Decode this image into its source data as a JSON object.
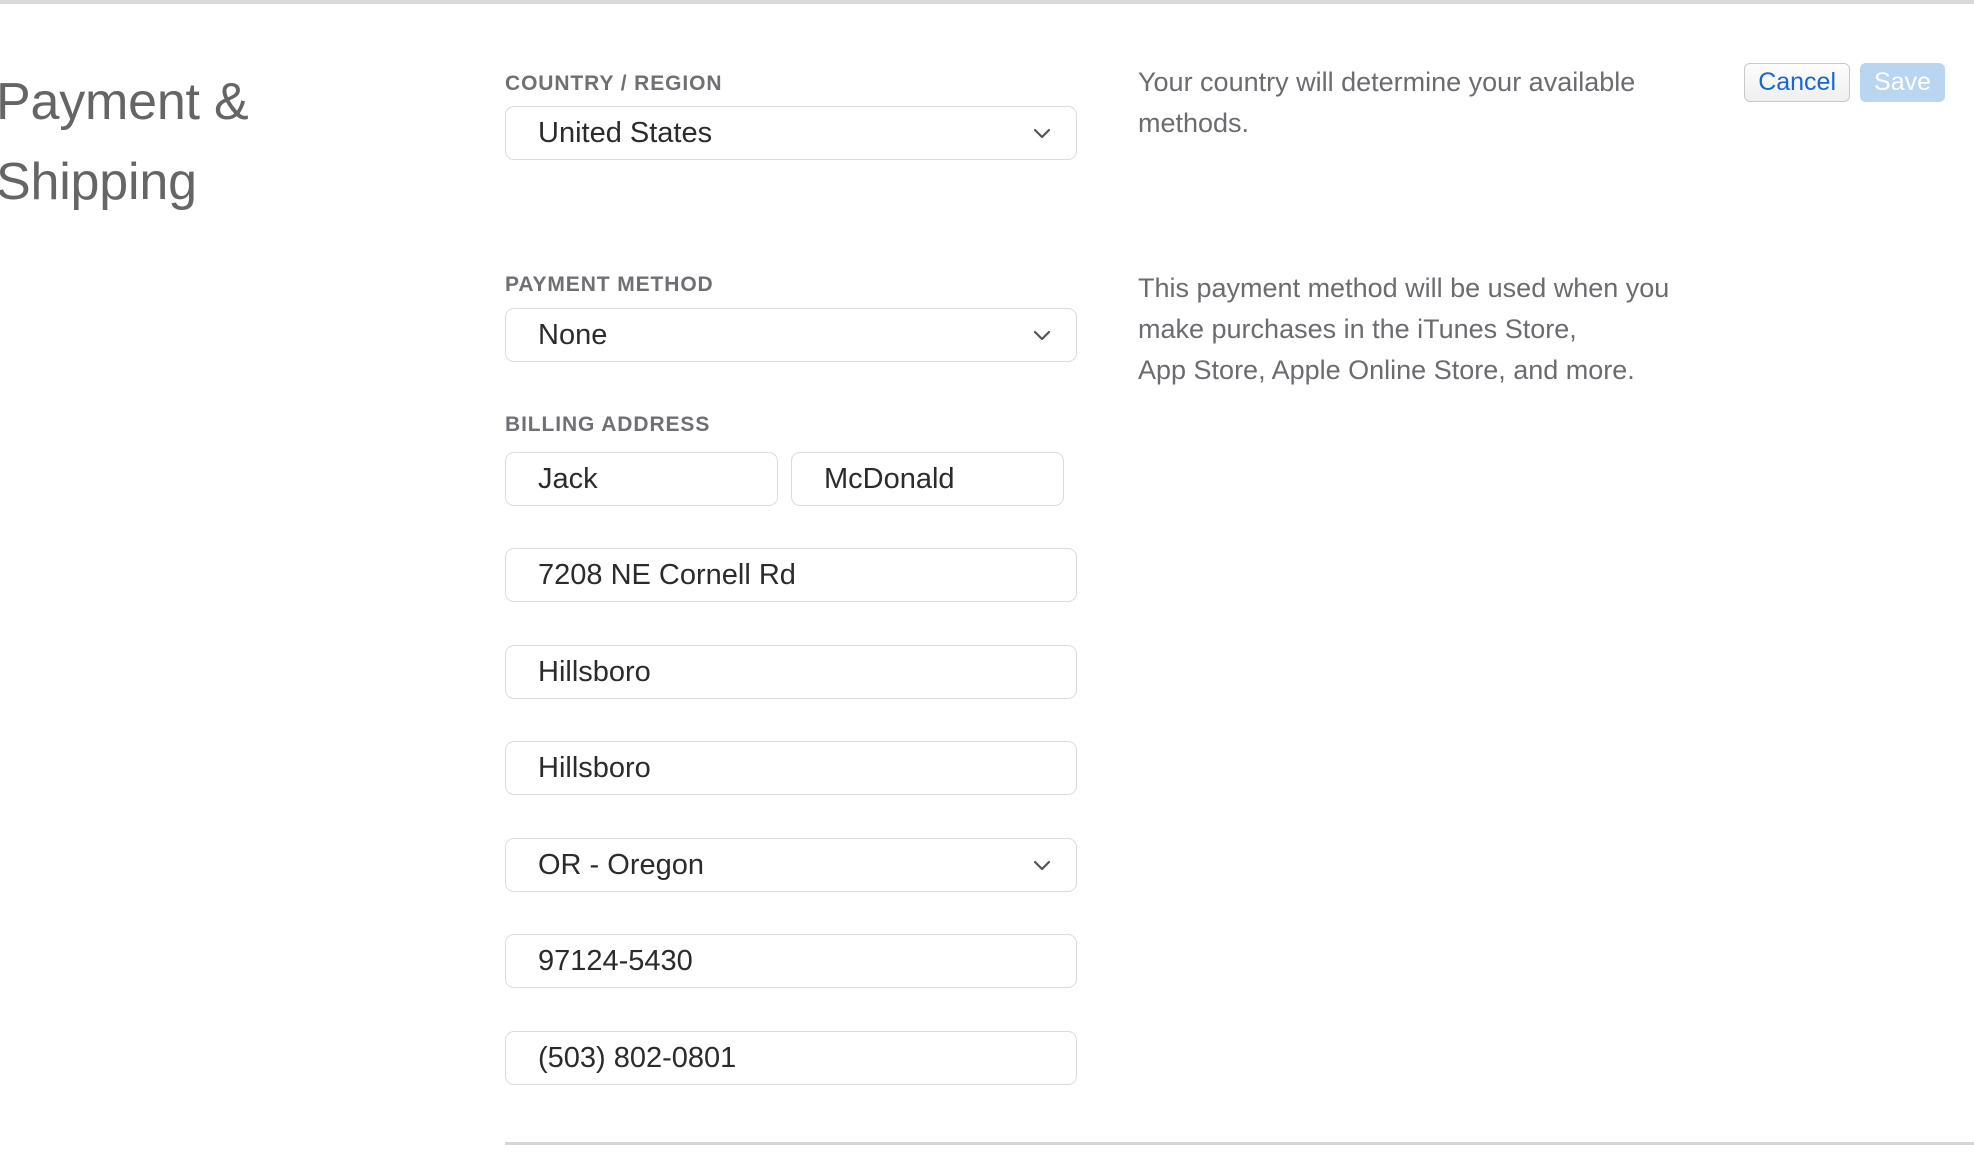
{
  "page": {
    "title": "Payment & Shipping"
  },
  "toolbar": {
    "cancel_label": "Cancel",
    "save_label": "Save",
    "cancel_text_color": "#1668d0",
    "save_background": "#b8d6f0"
  },
  "form": {
    "country": {
      "label": "COUNTRY / REGION",
      "value": "United States",
      "chevron": "chevron-down-icon",
      "helper_lines": [
        "Your country will determine your available",
        "methods."
      ]
    },
    "payment_method": {
      "label": "PAYMENT METHOD",
      "value": "None",
      "chevron": "chevron-down-icon",
      "helper_lines": [
        "This payment method will be used when you",
        "make purchases in the iTunes Store,",
        "App Store, Apple Online Store, and more."
      ]
    },
    "billing_address": {
      "label": "BILLING ADDRESS",
      "first_name": "Jack",
      "last_name": "McDonald",
      "street": "7208 NE Cornell Rd",
      "city": "Hillsboro",
      "district": "Hillsboro",
      "state": "OR - Oregon",
      "state_chevron": "chevron-down-icon",
      "postal_code": "97124-5430",
      "phone": "(503) 802-0801"
    }
  }
}
